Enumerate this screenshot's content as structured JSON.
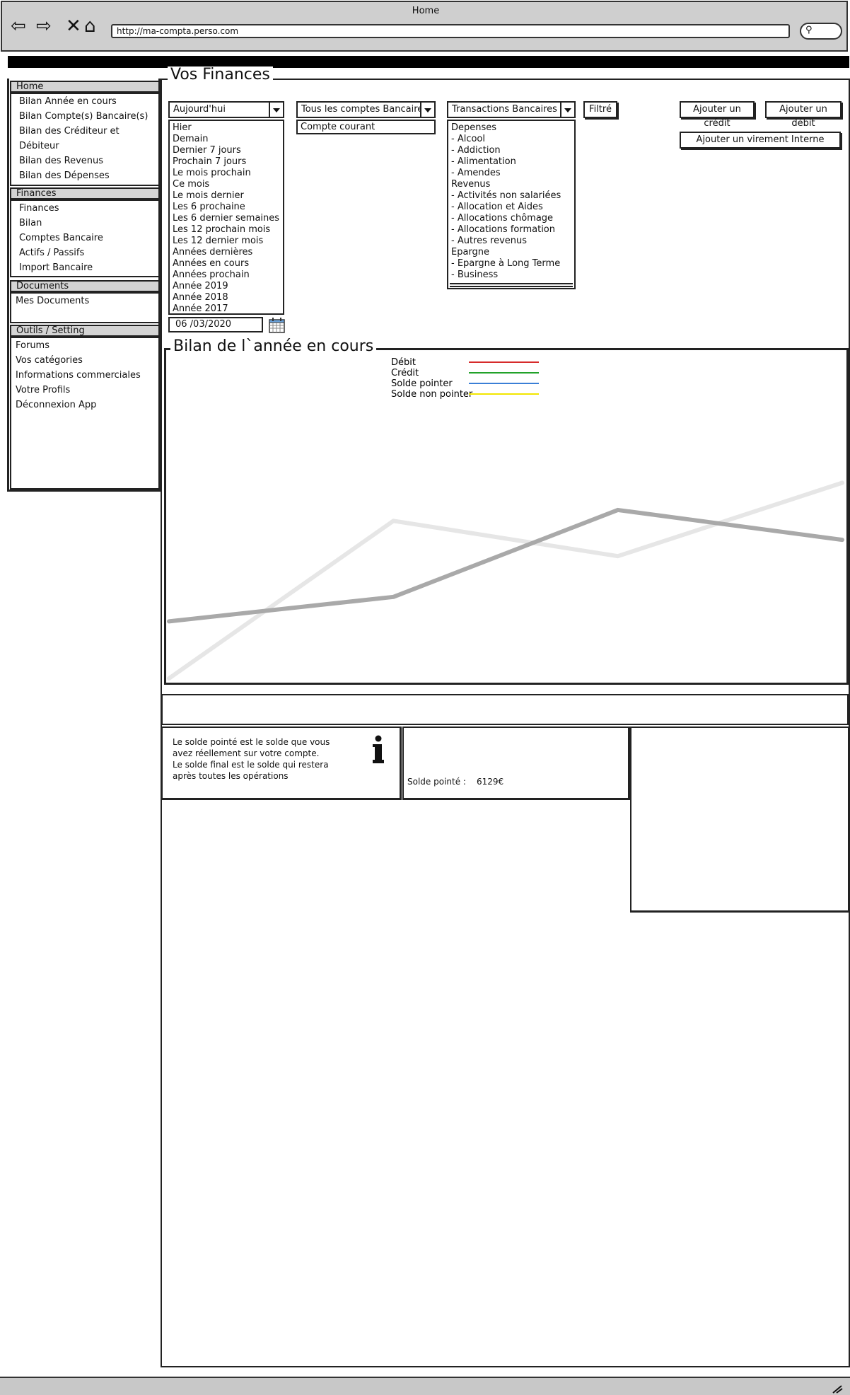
{
  "browser": {
    "title": "Home",
    "url": "http://ma-compta.perso.com",
    "search_glyph": "⚲"
  },
  "sidebar": {
    "home": {
      "header": "Home",
      "items": [
        "Bilan Année en cours",
        "Bilan Compte(s) Bancaire(s)",
        "Bilan des Créditeur et Débiteur",
        "Bilan des Revenus",
        "Bilan des Dépenses"
      ]
    },
    "finances": {
      "header": "Finances",
      "items": [
        "Finances",
        "Bilan",
        "Comptes Bancaire",
        "Actifs / Passifs",
        "Import Bancaire"
      ]
    },
    "documents": {
      "header": "Documents",
      "items": [
        "Mes Documents"
      ]
    },
    "outils": {
      "header": "Outils / Setting",
      "items": [
        "Forums",
        "Vos catégories",
        "Informations commerciales",
        "Votre Profils",
        "Déconnexion App"
      ]
    }
  },
  "main": {
    "section_title": "Vos Finances",
    "period_select": {
      "value": "Aujourd'hui",
      "options": [
        "Hier",
        "Demain",
        "Dernier 7 jours",
        "Prochain 7 jours",
        "Le mois prochain",
        "Ce mois",
        "Le mois dernier",
        "Les 6 prochaine",
        "Les 6 dernier semaines",
        "Les 12 prochain mois",
        "Les 12 dernier mois",
        "Années dernières",
        "Années en cours",
        "Années prochain",
        "Année 2019",
        "Année 2018",
        "Année 2017"
      ]
    },
    "account_select": {
      "value": "Tous les comptes Bancaires",
      "options": [
        "Compte courant"
      ]
    },
    "transaction_select": {
      "value": "Transactions Bancaires",
      "options": [
        "Depenses",
        "- Alcool",
        "- Addiction",
        "- Alimentation",
        "- Amendes",
        "Revenus",
        "- Activités non salariées",
        "- Allocation et Aides",
        "- Allocations chômage",
        "- Allocations formation",
        "- Autres revenus",
        "Epargne",
        "- Epargne à Long Terme",
        "- Business"
      ]
    },
    "filter_button": "Filtré",
    "add_credit_button": "Ajouter un crédit",
    "add_debit_button": "Ajouter un débit",
    "transfer_button": "Ajouter un virement Interne",
    "date_value": "06 /03/2020",
    "chart_title": "Bilan de l`année en cours",
    "info_text": [
      "Le solde pointé est le solde que vous",
      "avez réellement sur votre compte.",
      "Le solde final est le solde qui restera",
      "après toutes les opérations"
    ],
    "balance_label": "Solde pointé :",
    "balance_value": "6129€"
  },
  "chart_data": {
    "type": "line",
    "title": "Bilan de l`année en cours",
    "legend": [
      {
        "name": "Débit",
        "color": "#d62b2b"
      },
      {
        "name": "Crédit",
        "color": "#22a22a"
      },
      {
        "name": "Solde pointer",
        "color": "#3a7fd6"
      },
      {
        "name": "Solde non pointer",
        "color": "#f2e600"
      }
    ],
    "series": [
      {
        "color": "#e6e6e6",
        "x": [
          0,
          1,
          2,
          3
        ],
        "y": [
          0,
          58,
          45,
          72
        ]
      },
      {
        "color": "#a9a9a9",
        "x": [
          0,
          1,
          2,
          3
        ],
        "y": [
          21,
          30,
          62,
          51
        ]
      }
    ],
    "ylim": [
      0,
      100
    ],
    "grid": false,
    "legend_position": "top-center"
  }
}
